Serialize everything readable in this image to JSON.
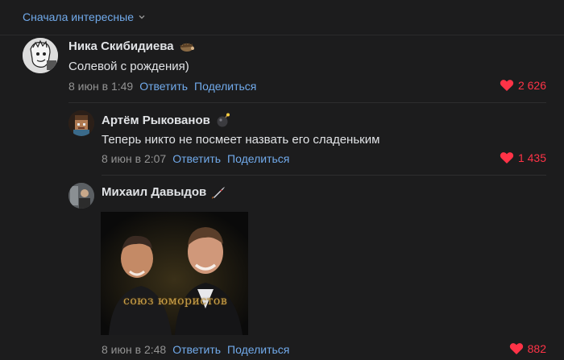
{
  "sort": {
    "label": "Сначала интересные"
  },
  "comments": [
    {
      "author": "Ника Скибидиева",
      "text": "Солевой с рождения)",
      "date": "8 июн в 1:49",
      "reply": "Ответить",
      "share": "Поделиться",
      "likes": "2 626"
    },
    {
      "author": "Артём Рыкованов",
      "text": "Теперь никто не посмеет назвать его сладеньким",
      "date": "8 июн в 2:07",
      "reply": "Ответить",
      "share": "Поделиться",
      "likes": "1 435"
    },
    {
      "author": "Михаил Давыдов",
      "text": "",
      "date": "8 июн в 2:48",
      "reply": "Ответить",
      "share": "Поделиться",
      "likes": "882",
      "photo_caption": "союз юмористов"
    }
  ],
  "colors": {
    "link": "#71aaeb",
    "like": "#ff3347",
    "background": "#1c1c1d"
  },
  "icons": [
    "chevron-down-icon",
    "heart-icon",
    "hedgehog-emoji-icon",
    "bomb-emoji-icon",
    "rocket-emoji-icon"
  ]
}
